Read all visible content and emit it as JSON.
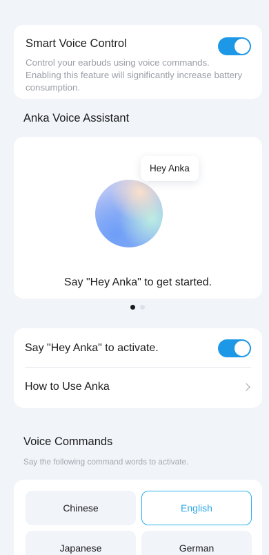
{
  "smart_voice": {
    "title": "Smart Voice Control",
    "description": "Control your earbuds using voice commands. Enabling this feature will significantly increase battery consumption.",
    "enabled": true
  },
  "assistant": {
    "heading": "Anka Voice Assistant",
    "bubble_text": "Hey Anka",
    "caption": "Say \"Hey Anka\" to get started.",
    "carousel": {
      "current_page": 1,
      "total_pages": 2
    }
  },
  "settings": {
    "activate_label": "Say \"Hey Anka\" to activate.",
    "activate_enabled": true,
    "howto_label": "How to Use Anka"
  },
  "commands": {
    "heading": "Voice Commands",
    "subheading": "Say the following command words to activate.",
    "languages": [
      {
        "label": "Chinese",
        "selected": false
      },
      {
        "label": "English",
        "selected": true
      },
      {
        "label": "Japanese",
        "selected": false
      },
      {
        "label": "German",
        "selected": false
      }
    ]
  },
  "colors": {
    "background": "#f1f4f8",
    "accent": "#1d98e6",
    "selected_text": "#2aa8e6",
    "secondary_text": "#9a9ea6"
  },
  "icons": [
    "chevron-right-icon"
  ]
}
